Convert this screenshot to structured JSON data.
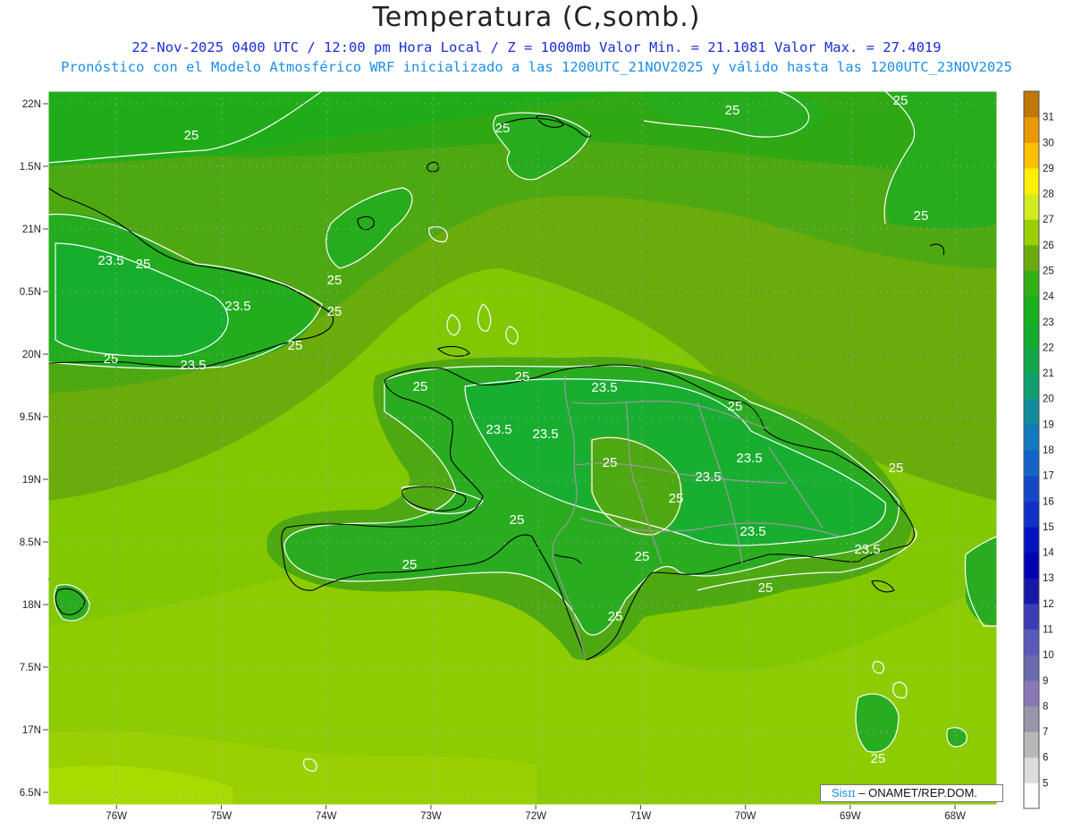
{
  "header": {
    "title": "Temperatura (C,somb.)",
    "subtitle_line1": "22-Nov-2025 0400 UTC / 12:00 pm Hora Local / Z = 1000mb  Valor Min. = 21.1081  Valor Max. = 27.4019",
    "subtitle_line2": "Pronóstico con el Modelo Atmosférico WRF inicializado a las 1200UTC_21NOV2025 y válido hasta las  1200UTC_23NOV2025"
  },
  "axes": {
    "lat_labels": [
      "22N",
      "1.5N",
      "21N",
      "0.5N",
      "20N",
      "9.5N",
      "19N",
      "8.5N",
      "18N",
      "7.5N",
      "17N",
      "6.5N"
    ],
    "lat_values": [
      22,
      21.5,
      21,
      20.5,
      20,
      19.5,
      19,
      18.5,
      18,
      17.5,
      17,
      16.5
    ],
    "lon_labels": [
      "76W",
      "75W",
      "74W",
      "73W",
      "72W",
      "71W",
      "70W",
      "69W",
      "68W"
    ],
    "lon_values": [
      -76,
      -75,
      -74,
      -73,
      -72,
      -71,
      -70,
      -69,
      -68
    ],
    "lon_range": [
      -76.65,
      -67.6
    ],
    "lat_range": [
      16.4,
      22.1
    ],
    "grid": true
  },
  "colorbar": {
    "levels": [
      "5",
      "6",
      "7",
      "8",
      "9",
      "10",
      "11",
      "12",
      "13",
      "14",
      "15",
      "16",
      "17",
      "18",
      "19",
      "20",
      "21",
      "22",
      "23",
      "24",
      "25",
      "26",
      "27",
      "28",
      "29",
      "30",
      "31"
    ],
    "colors": [
      "#ffffff",
      "#dcdcdc",
      "#b8b8b8",
      "#9696a6",
      "#8a78b4",
      "#6a6ab0",
      "#5a5aba",
      "#3c3cb4",
      "#1818a8",
      "#0000b4",
      "#0014c0",
      "#1230c8",
      "#1448c8",
      "#1464c8",
      "#1478c0",
      "#128c9a",
      "#10a070",
      "#12a84a",
      "#14ae2e",
      "#18b01c",
      "#32b016",
      "#6aac0c",
      "#9ad000",
      "#d0ec20",
      "#fff000",
      "#ffc000",
      "#e89800",
      "#c07800"
    ]
  },
  "contour_labels": [
    "25",
    "25",
    "25",
    "25",
    "25",
    "25",
    "23.5",
    "25",
    "23.5",
    "25",
    "23.5",
    "25",
    "23.5",
    "25",
    "25",
    "23.5",
    "23.5",
    "23.5",
    "25",
    "23.5",
    "25",
    "25",
    "25",
    "23.5",
    "25",
    "23.5",
    "25",
    "25",
    "25",
    "25"
  ],
  "credit": {
    "brand": "Sis",
    "pi": "π",
    "text": "– ONAMET/REP.DOM."
  },
  "colors": {
    "zone_23": "#14ae2e",
    "zone_24": "#18b01c",
    "zone_25": "#4eaa10",
    "zone_26": "#6aac0c",
    "zone_26b": "#82c800",
    "zone_27": "#9ad000",
    "contour": "#ffffff",
    "border": "#9a9a9a",
    "coast": "#000000"
  }
}
